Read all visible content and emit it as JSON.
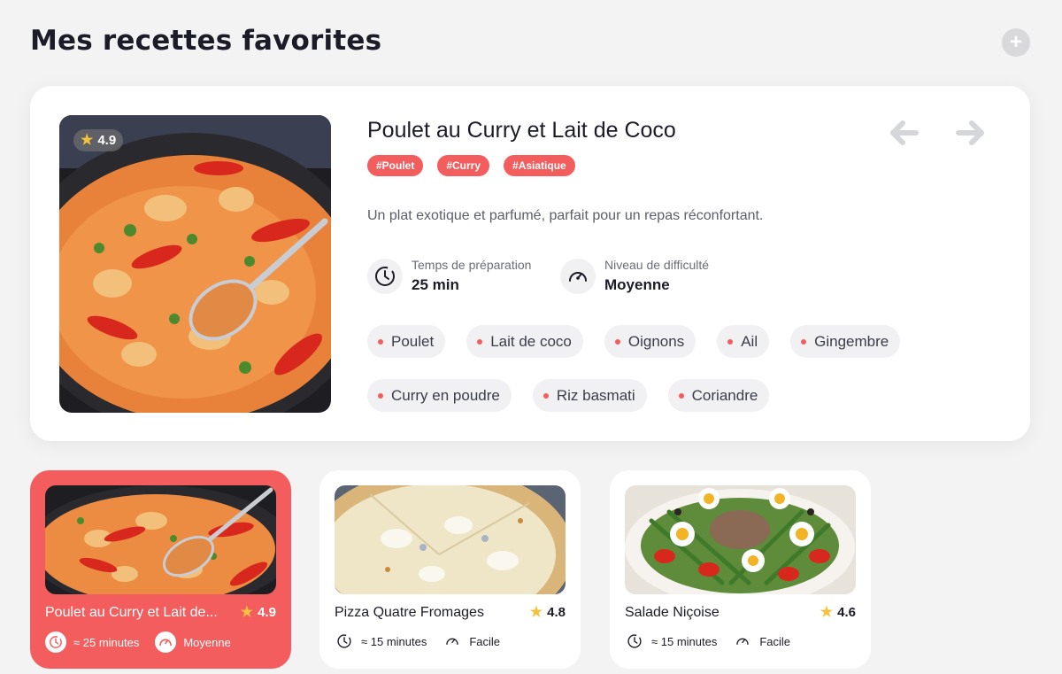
{
  "page": {
    "title": "Mes recettes favorites",
    "add_label": "+"
  },
  "featured": {
    "title": "Poulet au Curry et Lait de Coco",
    "rating": "4.9",
    "tags": [
      "#Poulet",
      "#Curry",
      "#Asiatique"
    ],
    "description": "Un plat exotique et parfumé, parfait pour un repas réconfortant.",
    "prep_label": "Temps de préparation",
    "prep_value": "25 min",
    "difficulty_label": "Niveau de difficulté",
    "difficulty_value": "Moyenne",
    "ingredients": [
      "Poulet",
      "Lait de coco",
      "Oignons",
      "Ail",
      "Gingembre",
      "Curry en poudre",
      "Riz basmati",
      "Coriandre"
    ]
  },
  "cards": [
    {
      "title": "Poulet au Curry et Lait de...",
      "rating": "4.9",
      "time": "≈ 25 minutes",
      "difficulty": "Moyenne"
    },
    {
      "title": "Pizza Quatre Fromages",
      "rating": "4.8",
      "time": "≈ 15 minutes",
      "difficulty": "Facile"
    },
    {
      "title": "Salade Niçoise",
      "rating": "4.6",
      "time": "≈ 15 minutes",
      "difficulty": "Facile"
    }
  ],
  "colors": {
    "accent": "#f45d5d",
    "star": "#f6c23e",
    "background": "#f3f3f4"
  }
}
